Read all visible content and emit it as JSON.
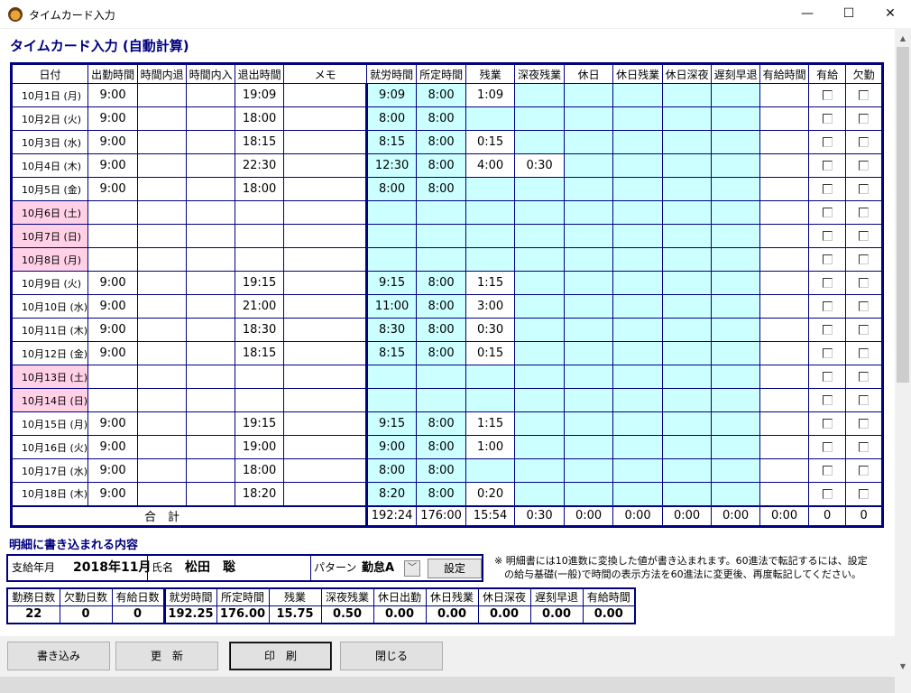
{
  "window": {
    "title": "タイムカード入力",
    "min": "—",
    "max": "☐",
    "close": "✕"
  },
  "page_title": "タイムカード入力 (自動計算)",
  "columns": [
    "日付",
    "出勤時間",
    "時間内退",
    "時間内入",
    "退出時間",
    "メモ",
    "就労時間",
    "所定時間",
    "残業",
    "深夜残業",
    "休日",
    "休日残業",
    "休日深夜",
    "遅刻早退",
    "有給時間",
    "有給",
    "欠勤"
  ],
  "rows": [
    {
      "date": "10月1日 (月)",
      "in": "9:00",
      "out": "19:09",
      "work": "9:09",
      "std": "8:00",
      "ot": "1:09",
      "night": ""
    },
    {
      "date": "10月2日 (火)",
      "in": "9:00",
      "out": "18:00",
      "work": "8:00",
      "std": "8:00",
      "ot": "",
      "night": ""
    },
    {
      "date": "10月3日 (水)",
      "in": "9:00",
      "out": "18:15",
      "work": "8:15",
      "std": "8:00",
      "ot": "0:15",
      "night": ""
    },
    {
      "date": "10月4日 (木)",
      "in": "9:00",
      "out": "22:30",
      "work": "12:30",
      "std": "8:00",
      "ot": "4:00",
      "night": "0:30"
    },
    {
      "date": "10月5日 (金)",
      "in": "9:00",
      "out": "18:00",
      "work": "8:00",
      "std": "8:00",
      "ot": "",
      "night": ""
    },
    {
      "date": "10月6日 (土)",
      "in": "",
      "out": "",
      "work": "",
      "std": "",
      "ot": "",
      "night": ""
    },
    {
      "date": "10月7日 (日)",
      "in": "",
      "out": "",
      "work": "",
      "std": "",
      "ot": "",
      "night": ""
    },
    {
      "date": "10月8日 (月)",
      "in": "",
      "out": "",
      "work": "",
      "std": "",
      "ot": "",
      "night": ""
    },
    {
      "date": "10月9日 (火)",
      "in": "9:00",
      "out": "19:15",
      "work": "9:15",
      "std": "8:00",
      "ot": "1:15",
      "night": ""
    },
    {
      "date": "10月10日 (水)",
      "in": "9:00",
      "out": "21:00",
      "work": "11:00",
      "std": "8:00",
      "ot": "3:00",
      "night": ""
    },
    {
      "date": "10月11日 (木)",
      "in": "9:00",
      "out": "18:30",
      "work": "8:30",
      "std": "8:00",
      "ot": "0:30",
      "night": ""
    },
    {
      "date": "10月12日 (金)",
      "in": "9:00",
      "out": "18:15",
      "work": "8:15",
      "std": "8:00",
      "ot": "0:15",
      "night": ""
    },
    {
      "date": "10月13日 (土)",
      "in": "",
      "out": "",
      "work": "",
      "std": "",
      "ot": "",
      "night": ""
    },
    {
      "date": "10月14日 (日)",
      "in": "",
      "out": "",
      "work": "",
      "std": "",
      "ot": "",
      "night": ""
    },
    {
      "date": "10月15日 (月)",
      "in": "9:00",
      "out": "19:15",
      "work": "9:15",
      "std": "8:00",
      "ot": "1:15",
      "night": ""
    },
    {
      "date": "10月16日 (火)",
      "in": "9:00",
      "out": "19:00",
      "work": "9:00",
      "std": "8:00",
      "ot": "1:00",
      "night": ""
    },
    {
      "date": "10月17日 (水)",
      "in": "9:00",
      "out": "18:00",
      "work": "8:00",
      "std": "8:00",
      "ot": "",
      "night": ""
    },
    {
      "date": "10月18日 (木)",
      "in": "9:00",
      "out": "18:20",
      "work": "8:20",
      "std": "8:00",
      "ot": "0:20",
      "night": ""
    }
  ],
  "holiday_row_indexes": [
    5,
    6,
    7,
    12,
    13
  ],
  "total": {
    "label": "合　計",
    "work": "192:24",
    "std": "176:00",
    "ot": "15:54",
    "night": "0:30",
    "kyujitsu": "0:00",
    "kyu_ot": "0:00",
    "kyu_night": "0:00",
    "late": "0:00",
    "paid_time": "0:00",
    "paid": "0",
    "absent": "0"
  },
  "detail_title": "明細に書き込まれる内容",
  "info": {
    "ym_label": "支給年月",
    "ym_value": "2018年11月",
    "name_label": "氏名",
    "name_value": "松田　聡",
    "pattern_label": "パターン",
    "pattern_value": "勤怠A",
    "set_button": "設定"
  },
  "note_lines": [
    "※ 明細書には10進数に変換した値が書き込まれます。60進法で転記するには、設定",
    "　の給与基礎(一般)で時間の表示方法を60進法に変更後、再度転記してください。"
  ],
  "summary": {
    "headers": [
      "勤務日数",
      "欠勤日数",
      "有給日数",
      "就労時間",
      "所定時間",
      "残業",
      "深夜残業",
      "休日出勤",
      "休日残業",
      "休日深夜",
      "遅刻早退",
      "有給時間"
    ],
    "values": [
      "22",
      "0",
      "0",
      "192.25",
      "176.00",
      "15.75",
      "0.50",
      "0.00",
      "0.00",
      "0.00",
      "0.00",
      "0.00"
    ]
  },
  "buttons": {
    "write": "書き込み",
    "update": "更　新",
    "print": "印　刷",
    "close": "閉じる"
  },
  "colors": {
    "navy": "#000080",
    "cyan": "#ccffff",
    "holiday": "#ffd0e6"
  }
}
